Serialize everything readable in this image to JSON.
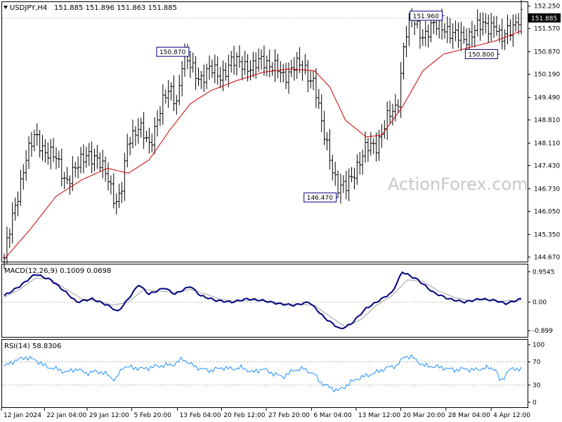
{
  "header": {
    "symbol": "USDJPY,H4",
    "ohlc": "151.885 151.896 151.863 151.885"
  },
  "watermark": "ActionForex.com",
  "colors": {
    "price": "#000000",
    "ma": "#cc0000",
    "macd": "#000080",
    "signal": "#a0a0a0",
    "rsi": "#1e90ff",
    "callout_border": "#000080",
    "grid_dash": "#888888"
  },
  "chart_data": [
    {
      "type": "line",
      "panel": "price",
      "title": "USDJPY,H4",
      "current_price": "151.885",
      "y_ticks": [
        "152.250",
        "151.570",
        "150.870",
        "150.190",
        "149.490",
        "148.810",
        "148.110",
        "147.430",
        "146.730",
        "146.050",
        "145.350",
        "144.670"
      ],
      "ylim": [
        144.55,
        152.35
      ],
      "x_ticks": [
        "12 Jan 2024",
        "22 Jan 04:00",
        "29 Jan 12:00",
        "5 Feb 20:00",
        "13 Feb 04:00",
        "20 Feb 12:00",
        "27 Feb 20:00",
        "6 Mar 04:00",
        "13 Mar 12:00",
        "20 Mar 20:00",
        "28 Mar 04:00",
        "4 Apr 12:00"
      ],
      "x_tick_pos": [
        0,
        0.082,
        0.163,
        0.248,
        0.335,
        0.419,
        0.504,
        0.59,
        0.675,
        0.76,
        0.846,
        0.932
      ],
      "callouts": [
        {
          "text": "150.870",
          "x": 0.36,
          "y": 150.87
        },
        {
          "text": "146.470",
          "x": 0.645,
          "y": 146.47
        },
        {
          "text": "151.960",
          "x": 0.85,
          "y": 151.96
        },
        {
          "text": "150.800",
          "x": 0.957,
          "y": 150.8
        }
      ],
      "series": [
        {
          "kind": "close",
          "points": [
            [
              0,
              144.65
            ],
            [
              0.02,
              146.1
            ],
            [
              0.04,
              147.6
            ],
            [
              0.06,
              148.3
            ],
            [
              0.08,
              147.9
            ],
            [
              0.1,
              147.6
            ],
            [
              0.12,
              147.0
            ],
            [
              0.14,
              147.3
            ],
            [
              0.16,
              147.9
            ],
            [
              0.18,
              147.5
            ],
            [
              0.2,
              147.2
            ],
            [
              0.215,
              146.3
            ],
            [
              0.225,
              146.4
            ],
            [
              0.24,
              148.3
            ],
            [
              0.26,
              148.6
            ],
            [
              0.28,
              148.0
            ],
            [
              0.3,
              149.1
            ],
            [
              0.32,
              149.7
            ],
            [
              0.335,
              149.4
            ],
            [
              0.345,
              150.7
            ],
            [
              0.36,
              150.4
            ],
            [
              0.38,
              150.1
            ],
            [
              0.4,
              150.3
            ],
            [
              0.42,
              150.2
            ],
            [
              0.44,
              150.5
            ],
            [
              0.46,
              150.6
            ],
            [
              0.48,
              150.3
            ],
            [
              0.5,
              150.7
            ],
            [
              0.52,
              150.4
            ],
            [
              0.54,
              150.1
            ],
            [
              0.56,
              150.5
            ],
            [
              0.58,
              150.3
            ],
            [
              0.6,
              150.0
            ],
            [
              0.615,
              148.5
            ],
            [
              0.63,
              147.7
            ],
            [
              0.645,
              146.8
            ],
            [
              0.66,
              146.7
            ],
            [
              0.68,
              147.4
            ],
            [
              0.7,
              147.9
            ],
            [
              0.72,
              148.1
            ],
            [
              0.74,
              148.8
            ],
            [
              0.76,
              149.2
            ],
            [
              0.775,
              151.4
            ],
            [
              0.79,
              151.8
            ],
            [
              0.81,
              151.4
            ],
            [
              0.83,
              151.6
            ],
            [
              0.85,
              151.7
            ],
            [
              0.87,
              151.3
            ],
            [
              0.89,
              151.3
            ],
            [
              0.91,
              151.5
            ],
            [
              0.93,
              151.7
            ],
            [
              0.95,
              151.7
            ],
            [
              0.96,
              151.1
            ],
            [
              0.975,
              151.6
            ],
            [
              1.0,
              151.885
            ]
          ]
        },
        {
          "kind": "ma",
          "points": [
            [
              0,
              144.6
            ],
            [
              0.05,
              145.5
            ],
            [
              0.1,
              146.5
            ],
            [
              0.15,
              147.0
            ],
            [
              0.2,
              147.35
            ],
            [
              0.24,
              147.2
            ],
            [
              0.28,
              147.6
            ],
            [
              0.32,
              148.5
            ],
            [
              0.36,
              149.3
            ],
            [
              0.4,
              149.7
            ],
            [
              0.45,
              150.0
            ],
            [
              0.5,
              150.25
            ],
            [
              0.55,
              150.35
            ],
            [
              0.6,
              150.3
            ],
            [
              0.63,
              149.8
            ],
            [
              0.66,
              148.8
            ],
            [
              0.7,
              148.3
            ],
            [
              0.73,
              148.35
            ],
            [
              0.77,
              149.2
            ],
            [
              0.81,
              150.3
            ],
            [
              0.85,
              150.8
            ],
            [
              0.9,
              151.0
            ],
            [
              0.95,
              151.2
            ],
            [
              1.0,
              151.5
            ]
          ]
        }
      ]
    },
    {
      "type": "line",
      "panel": "macd",
      "title": "MACD(12,26,9) 0.1009 0.0698",
      "y_ticks": [
        "0.9545",
        "0.00",
        "-0.899"
      ],
      "ylim": [
        -1.05,
        1.05
      ],
      "zero_label": "0.00",
      "series": [
        {
          "name": "MACD",
          "points": [
            [
              0,
              0.2
            ],
            [
              0.03,
              0.5
            ],
            [
              0.06,
              0.88
            ],
            [
              0.09,
              0.7
            ],
            [
              0.12,
              0.3
            ],
            [
              0.14,
              0.0
            ],
            [
              0.17,
              0.1
            ],
            [
              0.2,
              -0.1
            ],
            [
              0.22,
              -0.3
            ],
            [
              0.24,
              0.1
            ],
            [
              0.26,
              0.55
            ],
            [
              0.28,
              0.25
            ],
            [
              0.31,
              0.45
            ],
            [
              0.33,
              0.25
            ],
            [
              0.36,
              0.5
            ],
            [
              0.38,
              0.2
            ],
            [
              0.41,
              0.05
            ],
            [
              0.44,
              0.0
            ],
            [
              0.47,
              0.1
            ],
            [
              0.5,
              0.05
            ],
            [
              0.53,
              -0.05
            ],
            [
              0.56,
              -0.1
            ],
            [
              0.59,
              0.0
            ],
            [
              0.62,
              -0.5
            ],
            [
              0.65,
              -0.85
            ],
            [
              0.67,
              -0.7
            ],
            [
              0.7,
              -0.2
            ],
            [
              0.73,
              0.1
            ],
            [
              0.75,
              0.3
            ],
            [
              0.77,
              0.95
            ],
            [
              0.8,
              0.7
            ],
            [
              0.83,
              0.3
            ],
            [
              0.86,
              0.1
            ],
            [
              0.89,
              0.0
            ],
            [
              0.92,
              0.1
            ],
            [
              0.95,
              0.05
            ],
            [
              0.97,
              -0.05
            ],
            [
              1.0,
              0.1
            ]
          ]
        },
        {
          "name": "Signal",
          "points": [
            [
              0,
              0.15
            ],
            [
              0.03,
              0.4
            ],
            [
              0.06,
              0.75
            ],
            [
              0.09,
              0.72
            ],
            [
              0.12,
              0.4
            ],
            [
              0.15,
              0.1
            ],
            [
              0.18,
              0.05
            ],
            [
              0.21,
              -0.1
            ],
            [
              0.24,
              0.0
            ],
            [
              0.27,
              0.4
            ],
            [
              0.3,
              0.35
            ],
            [
              0.33,
              0.3
            ],
            [
              0.36,
              0.4
            ],
            [
              0.39,
              0.25
            ],
            [
              0.42,
              0.08
            ],
            [
              0.45,
              0.02
            ],
            [
              0.48,
              0.06
            ],
            [
              0.51,
              0.03
            ],
            [
              0.54,
              -0.05
            ],
            [
              0.57,
              -0.08
            ],
            [
              0.6,
              -0.1
            ],
            [
              0.63,
              -0.45
            ],
            [
              0.66,
              -0.78
            ],
            [
              0.69,
              -0.55
            ],
            [
              0.72,
              -0.1
            ],
            [
              0.75,
              0.2
            ],
            [
              0.78,
              0.7
            ],
            [
              0.81,
              0.65
            ],
            [
              0.84,
              0.35
            ],
            [
              0.87,
              0.15
            ],
            [
              0.9,
              0.05
            ],
            [
              0.93,
              0.07
            ],
            [
              0.96,
              0.03
            ],
            [
              1.0,
              0.07
            ]
          ]
        }
      ]
    },
    {
      "type": "line",
      "panel": "rsi",
      "title": "RSI(14) 58.8306",
      "y_ticks": [
        "100",
        "70",
        "30",
        "0"
      ],
      "ylim": [
        0,
        100
      ],
      "series": [
        {
          "name": "RSI(14)",
          "points": [
            [
              0,
              62
            ],
            [
              0.02,
              72
            ],
            [
              0.04,
              78
            ],
            [
              0.06,
              74
            ],
            [
              0.08,
              62
            ],
            [
              0.1,
              58
            ],
            [
              0.12,
              52
            ],
            [
              0.14,
              58
            ],
            [
              0.16,
              50
            ],
            [
              0.18,
              54
            ],
            [
              0.2,
              48
            ],
            [
              0.215,
              38
            ],
            [
              0.23,
              62
            ],
            [
              0.25,
              60
            ],
            [
              0.27,
              58
            ],
            [
              0.29,
              62
            ],
            [
              0.31,
              64
            ],
            [
              0.33,
              66
            ],
            [
              0.345,
              76
            ],
            [
              0.36,
              66
            ],
            [
              0.38,
              58
            ],
            [
              0.4,
              55
            ],
            [
              0.42,
              60
            ],
            [
              0.44,
              58
            ],
            [
              0.46,
              60
            ],
            [
              0.48,
              52
            ],
            [
              0.5,
              58
            ],
            [
              0.52,
              50
            ],
            [
              0.54,
              44
            ],
            [
              0.56,
              56
            ],
            [
              0.58,
              58
            ],
            [
              0.6,
              48
            ],
            [
              0.615,
              32
            ],
            [
              0.63,
              26
            ],
            [
              0.645,
              20
            ],
            [
              0.66,
              28
            ],
            [
              0.68,
              40
            ],
            [
              0.7,
              46
            ],
            [
              0.72,
              52
            ],
            [
              0.74,
              60
            ],
            [
              0.76,
              64
            ],
            [
              0.775,
              80
            ],
            [
              0.79,
              78
            ],
            [
              0.81,
              64
            ],
            [
              0.83,
              62
            ],
            [
              0.85,
              60
            ],
            [
              0.87,
              56
            ],
            [
              0.89,
              58
            ],
            [
              0.91,
              56
            ],
            [
              0.93,
              60
            ],
            [
              0.95,
              58
            ],
            [
              0.96,
              34
            ],
            [
              0.975,
              56
            ],
            [
              1.0,
              58.83
            ]
          ]
        }
      ]
    }
  ]
}
